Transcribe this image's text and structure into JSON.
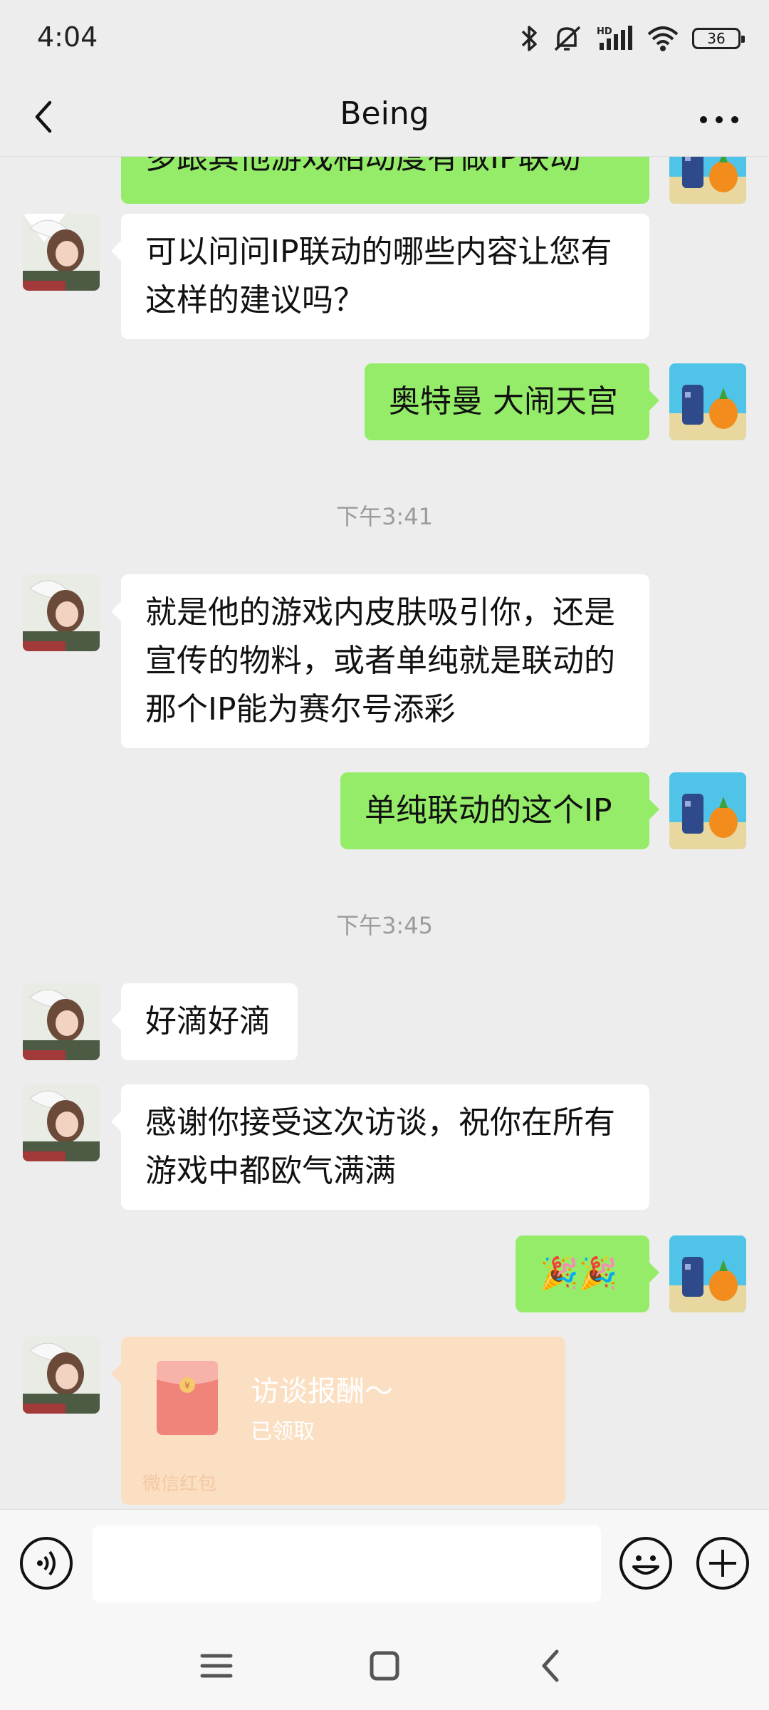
{
  "status_bar": {
    "time": "4:04",
    "battery": "36",
    "icons": [
      "bluetooth-icon",
      "mute-icon",
      "hd-signal-icon",
      "wifi-icon",
      "battery-icon"
    ]
  },
  "header": {
    "title": "Being",
    "back_icon": "chevron-left-icon",
    "more_icon": "more-dots-icon"
  },
  "messages": [
    {
      "side": "right",
      "type": "text",
      "text": "多跟其他游戏相动度有做IP联动"
    },
    {
      "side": "left",
      "type": "text",
      "text": "可以问问IP联动的哪些内容让您有这样的建议吗？"
    },
    {
      "side": "right",
      "type": "text",
      "text": "奥特曼 大闹天宫"
    },
    {
      "type": "time",
      "text": "下午3:41"
    },
    {
      "side": "left",
      "type": "text",
      "text": "就是他的游戏内皮肤吸引你，还是宣传的物料，或者单纯就是联动的那个IP能为赛尔号添彩"
    },
    {
      "side": "right",
      "type": "text",
      "text": "单纯联动的这个IP"
    },
    {
      "type": "time",
      "text": "下午3:45"
    },
    {
      "side": "left",
      "type": "text",
      "text": "好滴好滴"
    },
    {
      "side": "left",
      "type": "text",
      "text": "感谢你接受这次访谈，祝你在所有游戏中都欧气满满"
    },
    {
      "side": "right",
      "type": "emoji",
      "text": "🎉🎉"
    },
    {
      "side": "left",
      "type": "red_packet",
      "title": "访谈报酬～",
      "status": "已领取",
      "label": "微信红包"
    }
  ],
  "input_bar": {
    "voice_icon": "voice-icon",
    "emoji_icon": "emoji-icon",
    "plus_icon": "plus-icon"
  },
  "nav_bar": {
    "icons": [
      "menu-icon",
      "home-icon",
      "back-icon"
    ]
  },
  "colors": {
    "background": "#ededed",
    "sent_bubble": "#95ec69",
    "received_bubble": "#ffffff",
    "red_packet": "#fbdfc2",
    "timestamp": "#9b9b9b"
  }
}
